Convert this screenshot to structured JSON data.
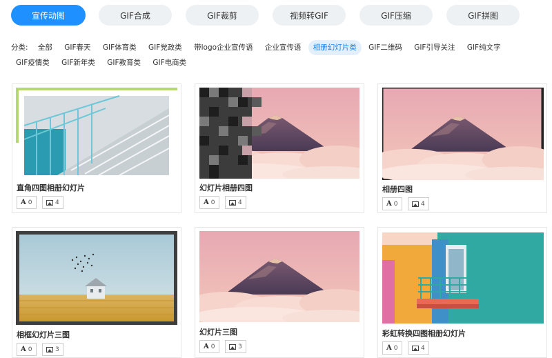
{
  "tabs": [
    "宣传动图",
    "GIF合成",
    "GIF裁剪",
    "视频转GIF",
    "GIF压缩",
    "GIF拼图"
  ],
  "active_tab": 0,
  "category_label": "分类:",
  "categories": [
    "全部",
    "GIF春天",
    "GIF体育类",
    "GIF党政类",
    "带logo企业宣传语",
    "企业宣传语",
    "相册幻灯片类",
    "GIF二维码",
    "GIF引导关注",
    "GIF纯文字",
    "GIF疫情类",
    "GIF新年类",
    "GIF教育类",
    "GIF电商类"
  ],
  "active_category": 6,
  "cards": [
    {
      "title": "直角四图相册幻灯片",
      "text_count": "0",
      "image_count": "4",
      "thumb": "stairs-photo"
    },
    {
      "title": "幻灯片相册四图",
      "text_count": "0",
      "image_count": "4",
      "thumb": "mountain-pixel-transition"
    },
    {
      "title": "相册四图",
      "text_count": "0",
      "image_count": "4",
      "thumb": "mountain-framed"
    },
    {
      "title": "相框幻灯片三图",
      "text_count": "0",
      "image_count": "3",
      "thumb": "field-house-framed"
    },
    {
      "title": "幻灯片三图",
      "text_count": "0",
      "image_count": "3",
      "thumb": "mountain-clouds"
    },
    {
      "title": "彩虹转换四图相册幻灯片",
      "text_count": "0",
      "image_count": "4",
      "thumb": "colorful-balcony"
    }
  ],
  "colors": {
    "accent": "#1e90ff",
    "tab_bg": "#eef1f3",
    "active_cat_bg": "#e3f0fc"
  }
}
